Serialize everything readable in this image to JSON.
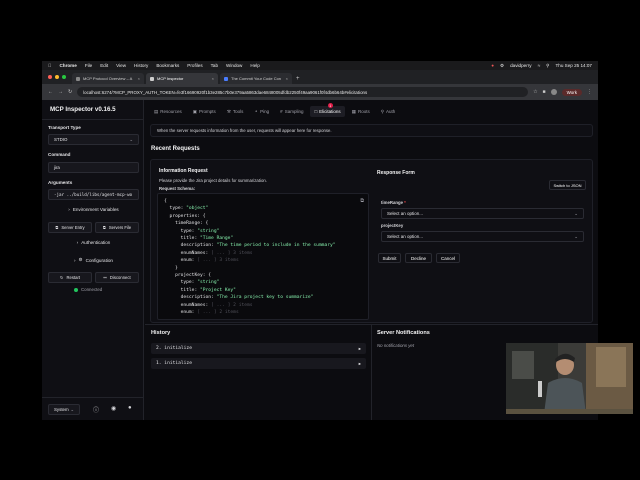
{
  "menubar": {
    "items": [
      "Chrome",
      "File",
      "Edit",
      "View",
      "History",
      "Bookmarks",
      "Profiles",
      "Tab",
      "Window",
      "Help"
    ],
    "user": "davidperry",
    "clock": "Thu Sep 25 14:07"
  },
  "browser": {
    "tabs": [
      {
        "title": "MCP Protocol Overview – A"
      },
      {
        "title": "MCP Inspector"
      },
      {
        "title": "The Commit Your Code Con"
      }
    ],
    "url": "localhost:6274/?MCP_PROXY_AUTH_TOKEN=fe3f16690920f1b3e285c7b0e379aa5863dae6848005dfdb2250f49aa9061f0f4db6b64b#elicitations",
    "profile": "Work"
  },
  "sidebar": {
    "title": "MCP Inspector v0.16.5",
    "transport_label": "Transport Type",
    "transport_value": "STDIO",
    "command_label": "Command",
    "command_value": "jira",
    "arguments_label": "Arguments",
    "arguments_value": "-jar ../build/libs/agent-mcp-wo",
    "env_label": "Environment Variables",
    "server_entry": "Server Entry",
    "servers_file": "Servers File",
    "auth_label": "Authentication",
    "config_label": "Configuration",
    "restart": "Restart",
    "disconnect": "Disconnect",
    "status": "Connected",
    "theme": "System"
  },
  "tabs": [
    {
      "label": "Resources"
    },
    {
      "label": "Prompts"
    },
    {
      "label": "Tools"
    },
    {
      "label": "Ping"
    },
    {
      "label": "Sampling"
    },
    {
      "label": "Elicitations",
      "badge": "1"
    },
    {
      "label": "Roots"
    },
    {
      "label": "Auth"
    }
  ],
  "notice": "When the server requests information from the user, requests will appear here for response.",
  "recent_title": "Recent Requests",
  "request": {
    "title": "Information Request",
    "prompt": "Please provide the Jira project details for summarization.",
    "schema_label": "Request Schema:",
    "code": {
      "l1": "{",
      "l2_key": "type: ",
      "l2_val": "\"object\"",
      "l3": "properties: {",
      "l4": "timeRange: {",
      "l5_key": "type: ",
      "l5_val": "\"string\"",
      "l6_key": "title: ",
      "l6_val": "\"Time Range\"",
      "l7_key": "description: ",
      "l7_val": "\"The time period to include in the summary\"",
      "l8_key": "enumNames: ",
      "l8_val": "[ ... ] 3 items",
      "l9_key": "enum: ",
      "l9_val": "[ ... ] 3 items",
      "l10": "}",
      "l11": "projectKey: {",
      "l12_key": "type: ",
      "l12_val": "\"string\"",
      "l13_key": "title: ",
      "l13_val": "\"Project Key\"",
      "l14_key": "description: ",
      "l14_val": "\"The Jira project key to summarize\"",
      "l15_key": "enumNames: ",
      "l15_val": "[ ... ] 2 items",
      "l16_key": "enum: ",
      "l16_val": "[ ... ] 2 items"
    }
  },
  "response_form": {
    "title": "Response Form",
    "switch_json": "Switch to JSON",
    "field1_label": "timeRange",
    "field1_req": "*",
    "field1_value": "Select an option...",
    "field2_label": "projectKey",
    "field2_value": "Select an option...",
    "submit": "Submit",
    "decline": "Decline",
    "cancel": "Cancel"
  },
  "history": {
    "title": "History",
    "rows": [
      "2. initialize",
      "1. initialize"
    ]
  },
  "notifications": {
    "title": "Server Notifications",
    "empty": "No notifications yet"
  }
}
